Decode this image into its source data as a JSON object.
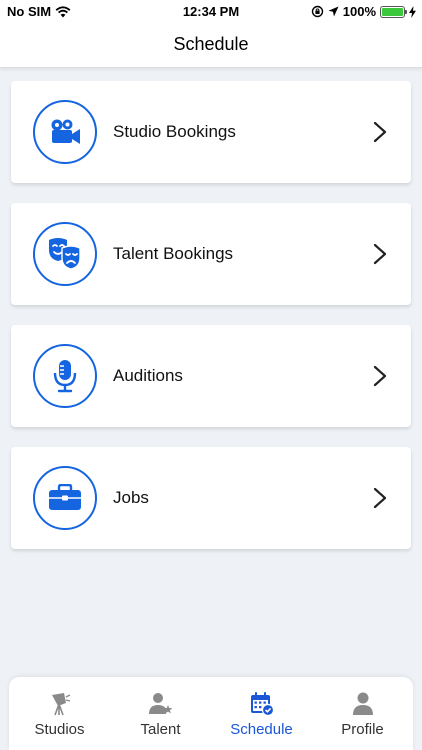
{
  "status": {
    "carrier": "No SIM",
    "time": "12:34 PM",
    "battery": "100%"
  },
  "header": {
    "title": "Schedule"
  },
  "items": [
    {
      "label": "Studio Bookings",
      "icon": "video-camera-icon"
    },
    {
      "label": "Talent Bookings",
      "icon": "theater-masks-icon"
    },
    {
      "label": "Auditions",
      "icon": "microphone-icon"
    },
    {
      "label": "Jobs",
      "icon": "briefcase-icon"
    }
  ],
  "tabs": [
    {
      "label": "Studios",
      "icon": "studio-light-icon"
    },
    {
      "label": "Talent",
      "icon": "person-star-icon"
    },
    {
      "label": "Schedule",
      "icon": "calendar-check-icon",
      "active": true
    },
    {
      "label": "Profile",
      "icon": "person-icon"
    }
  ],
  "colors": {
    "accent": "#1565e0",
    "active_tab": "#1a56d6",
    "background": "#eef1f6"
  }
}
